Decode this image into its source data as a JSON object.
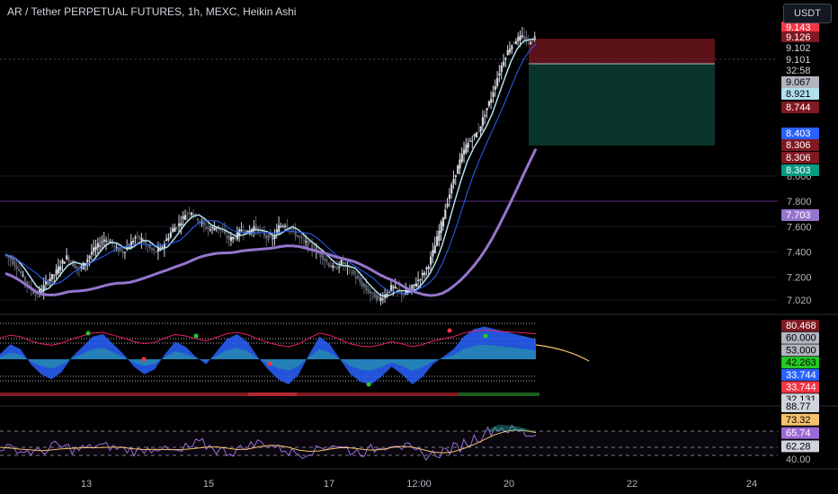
{
  "title": "AR / Tether PERPETUAL FUTURES, 1h, MEXC, Heikin Ashi",
  "currency": "USDT",
  "colors": {
    "bg": "#000000",
    "up": "#d1d4dc",
    "down": "#5d606b",
    "ma_fast": "#b2dfee",
    "ma_mid": "#2962ff",
    "ma_slow": "#9575cd",
    "short_stop": "#801922",
    "short_target": "#0b3b32",
    "rsi": "#9c6bd6",
    "rsi_ma": "#f5c26b"
  },
  "chart_data": [
    {
      "type": "candlestick",
      "title": "AR / Tether PERPETUAL FUTURES, 1h, MEXC, Heikin Ashi",
      "x_ticks": [
        "13",
        "15",
        "17",
        "12:00",
        "20",
        "22",
        "24"
      ],
      "y_ticks": [
        7.02,
        7.2,
        7.4,
        7.6,
        7.8,
        8.0
      ],
      "ylim": [
        6.92,
        9.18
      ],
      "price_path": [
        7.38,
        7.34,
        7.28,
        7.2,
        7.12,
        7.06,
        7.1,
        7.18,
        7.22,
        7.3,
        7.36,
        7.3,
        7.26,
        7.32,
        7.4,
        7.45,
        7.5,
        7.48,
        7.42,
        7.4,
        7.45,
        7.52,
        7.5,
        7.44,
        7.4,
        7.42,
        7.5,
        7.58,
        7.62,
        7.7,
        7.72,
        7.66,
        7.6,
        7.58,
        7.6,
        7.55,
        7.5,
        7.52,
        7.58,
        7.55,
        7.6,
        7.56,
        7.52,
        7.5,
        7.6,
        7.62,
        7.58,
        7.52,
        7.48,
        7.45,
        7.4,
        7.36,
        7.3,
        7.26,
        7.32,
        7.28,
        7.22,
        7.16,
        7.1,
        7.06,
        7.02,
        7.06,
        7.12,
        7.1,
        7.06,
        7.1,
        7.16,
        7.22,
        7.3,
        7.45,
        7.62,
        7.8,
        7.98,
        8.12,
        8.24,
        8.3,
        8.36,
        8.5,
        8.62,
        8.78,
        8.92,
        9.02,
        9.08,
        9.1,
        9.06,
        9.1
      ],
      "price_labels": [
        {
          "text": "9.143",
          "bg": "#f23645",
          "fg": "#ffffff"
        },
        {
          "text": "9.126",
          "bg": "#801922",
          "fg": "#ffffff"
        },
        {
          "text": "9.102",
          "bg": "#000000",
          "fg": "#d1d4dc"
        },
        {
          "text": "9.101",
          "bg": "#000000",
          "fg": "#d1d4dc"
        },
        {
          "text": "32:58",
          "bg": "#000000",
          "fg": "#d1d4dc"
        },
        {
          "text": "9.067",
          "bg": "#b2b5be",
          "fg": "#000000"
        },
        {
          "text": "8.921",
          "bg": "#b2dfee",
          "fg": "#000000"
        },
        {
          "text": "8.744",
          "bg": "#801922",
          "fg": "#ffffff"
        },
        {
          "text": "8.403",
          "bg": "#2962ff",
          "fg": "#ffffff"
        },
        {
          "text": "8.306",
          "bg": "#801922",
          "fg": "#ffffff"
        },
        {
          "text": "8.306",
          "bg": "#801922",
          "fg": "#ffffff"
        },
        {
          "text": "8.303",
          "bg": "#089981",
          "fg": "#ffffff"
        },
        {
          "text": "7.703",
          "bg": "#9575cd",
          "fg": "#ffffff"
        }
      ]
    },
    {
      "type": "area",
      "title": "",
      "values": [
        0.2,
        0.6,
        0.4,
        -0.2,
        -0.6,
        -0.8,
        -0.5,
        0.1,
        0.5,
        0.9,
        1.0,
        0.6,
        0.2,
        -0.3,
        -0.6,
        -0.4,
        0.2,
        0.7,
        0.5,
        0.1,
        -0.2,
        0.3,
        0.8,
        1.0,
        0.7,
        0.1,
        -0.4,
        -0.8,
        -1.0,
        -0.6,
        0.2,
        0.9,
        0.6,
        0.0,
        -0.6,
        -0.9,
        -1.0,
        -0.7,
        -0.3,
        -0.6,
        -1.0,
        -0.7,
        -0.2,
        0.1,
        0.4,
        0.9,
        1.2,
        1.3,
        1.2,
        1.1,
        1.0,
        0.9,
        0.8
      ],
      "labels": [
        {
          "text": "80.468",
          "bg": "#801922",
          "fg": "#ffffff"
        },
        {
          "text": "60.000",
          "bg": "#b2b5be",
          "fg": "#000000"
        },
        {
          "text": "53.000",
          "bg": "#b2b5be",
          "fg": "#000000"
        },
        {
          "text": "42.263",
          "bg": "#26c926",
          "fg": "#000000"
        },
        {
          "text": "33.744",
          "bg": "#2962ff",
          "fg": "#ffffff"
        },
        {
          "text": "33.744",
          "bg": "#f23645",
          "fg": "#ffffff"
        },
        {
          "text": "32.131",
          "bg": "#d1d4dc",
          "fg": "#000000"
        }
      ]
    },
    {
      "type": "line",
      "title": "",
      "rsi": [
        50,
        48,
        45,
        44,
        46,
        52,
        50,
        47,
        49,
        52,
        51,
        49,
        47,
        45,
        48,
        50,
        46,
        44,
        50,
        55,
        51,
        46,
        44,
        48,
        53,
        56,
        52,
        48,
        44,
        42,
        46,
        50,
        53,
        49,
        45,
        44,
        48,
        52,
        55,
        50,
        44,
        40,
        42,
        46,
        50,
        56,
        62,
        70,
        74,
        72,
        70,
        66,
        65
      ],
      "labels": [
        {
          "text": "88.77",
          "bg": "#d1d4dc",
          "fg": "#000000"
        },
        {
          "text": "73.32",
          "bg": "#f5c26b",
          "fg": "#000000"
        },
        {
          "text": "65.74",
          "bg": "#9c6bd6",
          "fg": "#ffffff"
        },
        {
          "text": "62.28",
          "bg": "#d1d4dc",
          "fg": "#000000"
        },
        {
          "text": "40.00",
          "bg": "#000000",
          "fg": "#b2b5be"
        }
      ]
    }
  ]
}
